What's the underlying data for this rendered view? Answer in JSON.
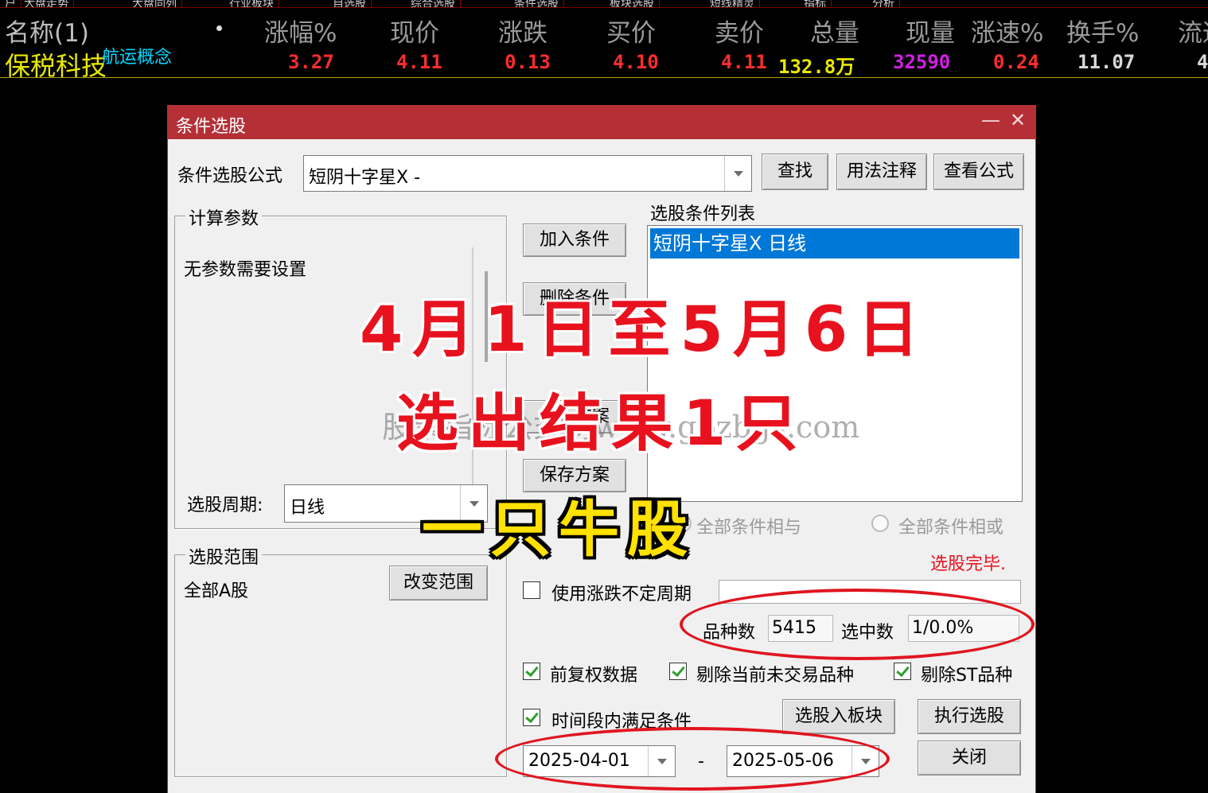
{
  "top_tabs": [
    "户",
    "大盘走势",
    "大盘同列",
    "行业板块",
    "自选股",
    "综合选股",
    "条件选股",
    "板块选股",
    "短线精灵",
    "指标",
    "分析"
  ],
  "quote": {
    "headers": {
      "name": "名称(1)",
      "change_pct": "涨幅%",
      "price": "现价",
      "change": "涨跌",
      "bid": "买价",
      "ask": "卖价",
      "volume": "总量",
      "cur_volume": "现量",
      "speed": "涨速%",
      "turnover": "换手%",
      "float": "流通"
    },
    "row": {
      "name": "保税科技",
      "concept": "航运概念",
      "change_pct": "3.27",
      "price": "4.11",
      "change": "0.13",
      "bid": "4.10",
      "ask": "4.11",
      "volume": "132.8万",
      "cur_volume": "32590",
      "speed": "0.24",
      "turnover": "11.07",
      "float": "4"
    },
    "colors": {
      "up": "#ff2d2d",
      "volume": "#e8e800",
      "cur_volume": "#d020e0",
      "turnover": "#d8d8d8"
    }
  },
  "dialog": {
    "title": "条件选股",
    "minimize": "—",
    "close": "✕",
    "formula_label": "条件选股公式",
    "formula_value": "短阴十字星X  -",
    "buttons": {
      "find": "查找",
      "usage": "用法注释",
      "view_formula": "查看公式",
      "add_condition": "加入条件",
      "delete_condition": "删除条件",
      "import_plan": "引入方案",
      "save_plan": "保存方案",
      "change_range": "改变范围",
      "to_block": "选股入板块",
      "execute": "执行选股",
      "close": "关闭"
    },
    "params_group": "计算参数",
    "no_params": "无参数需要设置",
    "period_label": "选股周期:",
    "period_value": "日线",
    "range_group": "选股范围",
    "range_value": "全部A股",
    "cond_list_label": "选股条件列表",
    "cond_items": [
      "短阴十字星X  日线"
    ],
    "radio_and": "全部条件相与",
    "radio_or": "全部条件相或",
    "status": "选股完毕.",
    "use_variable_period": "使用涨跌不定周期",
    "count_label": "品种数",
    "count_value": "5415",
    "selected_label": "选中数",
    "selected_value": "1/0.0%",
    "chk_forward_adj": "前复权数据",
    "chk_exclude_untraded": "剔除当前未交易品种",
    "chk_exclude_st": "剔除ST品种",
    "chk_time_range": "时间段内满足条件",
    "date_from": "2025-04-01",
    "date_sep": "-",
    "date_to": "2025-05-06"
  },
  "overlay": {
    "line1": "4月1日至5月6日",
    "line2": "选出结果1只",
    "line3": "一只牛股",
    "watermark": "股票指标公式网www.gpzbgs.com"
  }
}
